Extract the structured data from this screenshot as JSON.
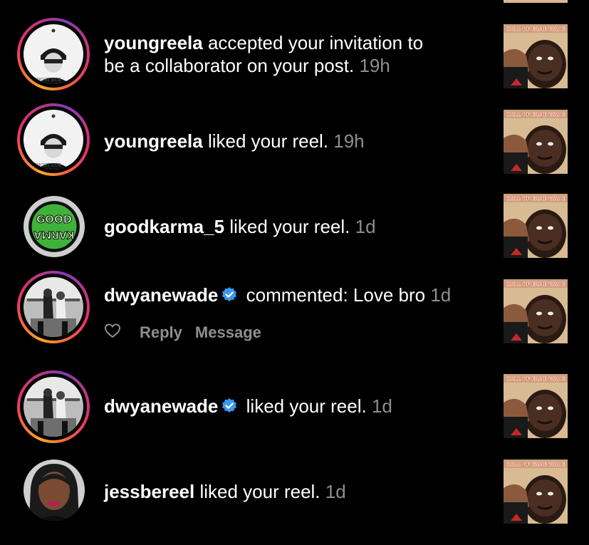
{
  "notifications": [
    {
      "username": "youngreela",
      "verified": false,
      "message": "accepted your invitation to be a collaborator on your post.",
      "message_line1": "accepted your invitation to",
      "message_line2": "be a collaborator on your post.",
      "time": "19h",
      "avatar": "youngreela-avatar"
    },
    {
      "username": "youngreela",
      "verified": false,
      "message": "liked your reel.",
      "time": "19h",
      "avatar": "youngreela-avatar"
    },
    {
      "username": "goodkarma_5",
      "verified": false,
      "message": "liked your reel.",
      "time": "1d",
      "avatar": "goodkarma-logo",
      "avatar_text_top": "GOOD",
      "avatar_text_bottom": "KARMA"
    },
    {
      "username": "dwyanewade",
      "verified": true,
      "message": "commented: Love bro",
      "time": "1d",
      "avatar": "dwyanewade-avatar",
      "actions": {
        "like_icon": "heart-outline-icon",
        "reply_label": "Reply",
        "message_label": "Message"
      }
    },
    {
      "username": "dwyanewade",
      "verified": true,
      "message": "liked your reel.",
      "time": "1d",
      "avatar": "dwyanewade-avatar"
    },
    {
      "username": "jessbereel",
      "verified": false,
      "message": "liked your reel.",
      "time": "1d",
      "avatar": "jessbereel-avatar"
    }
  ],
  "thumbnail": {
    "banner_text": "HALL OF FAME WADE",
    "banner_color": "#e53935"
  },
  "colors": {
    "background": "#000000",
    "text": "#ffffff",
    "secondary": "#8e8e8e",
    "verified": "#3897f0"
  }
}
